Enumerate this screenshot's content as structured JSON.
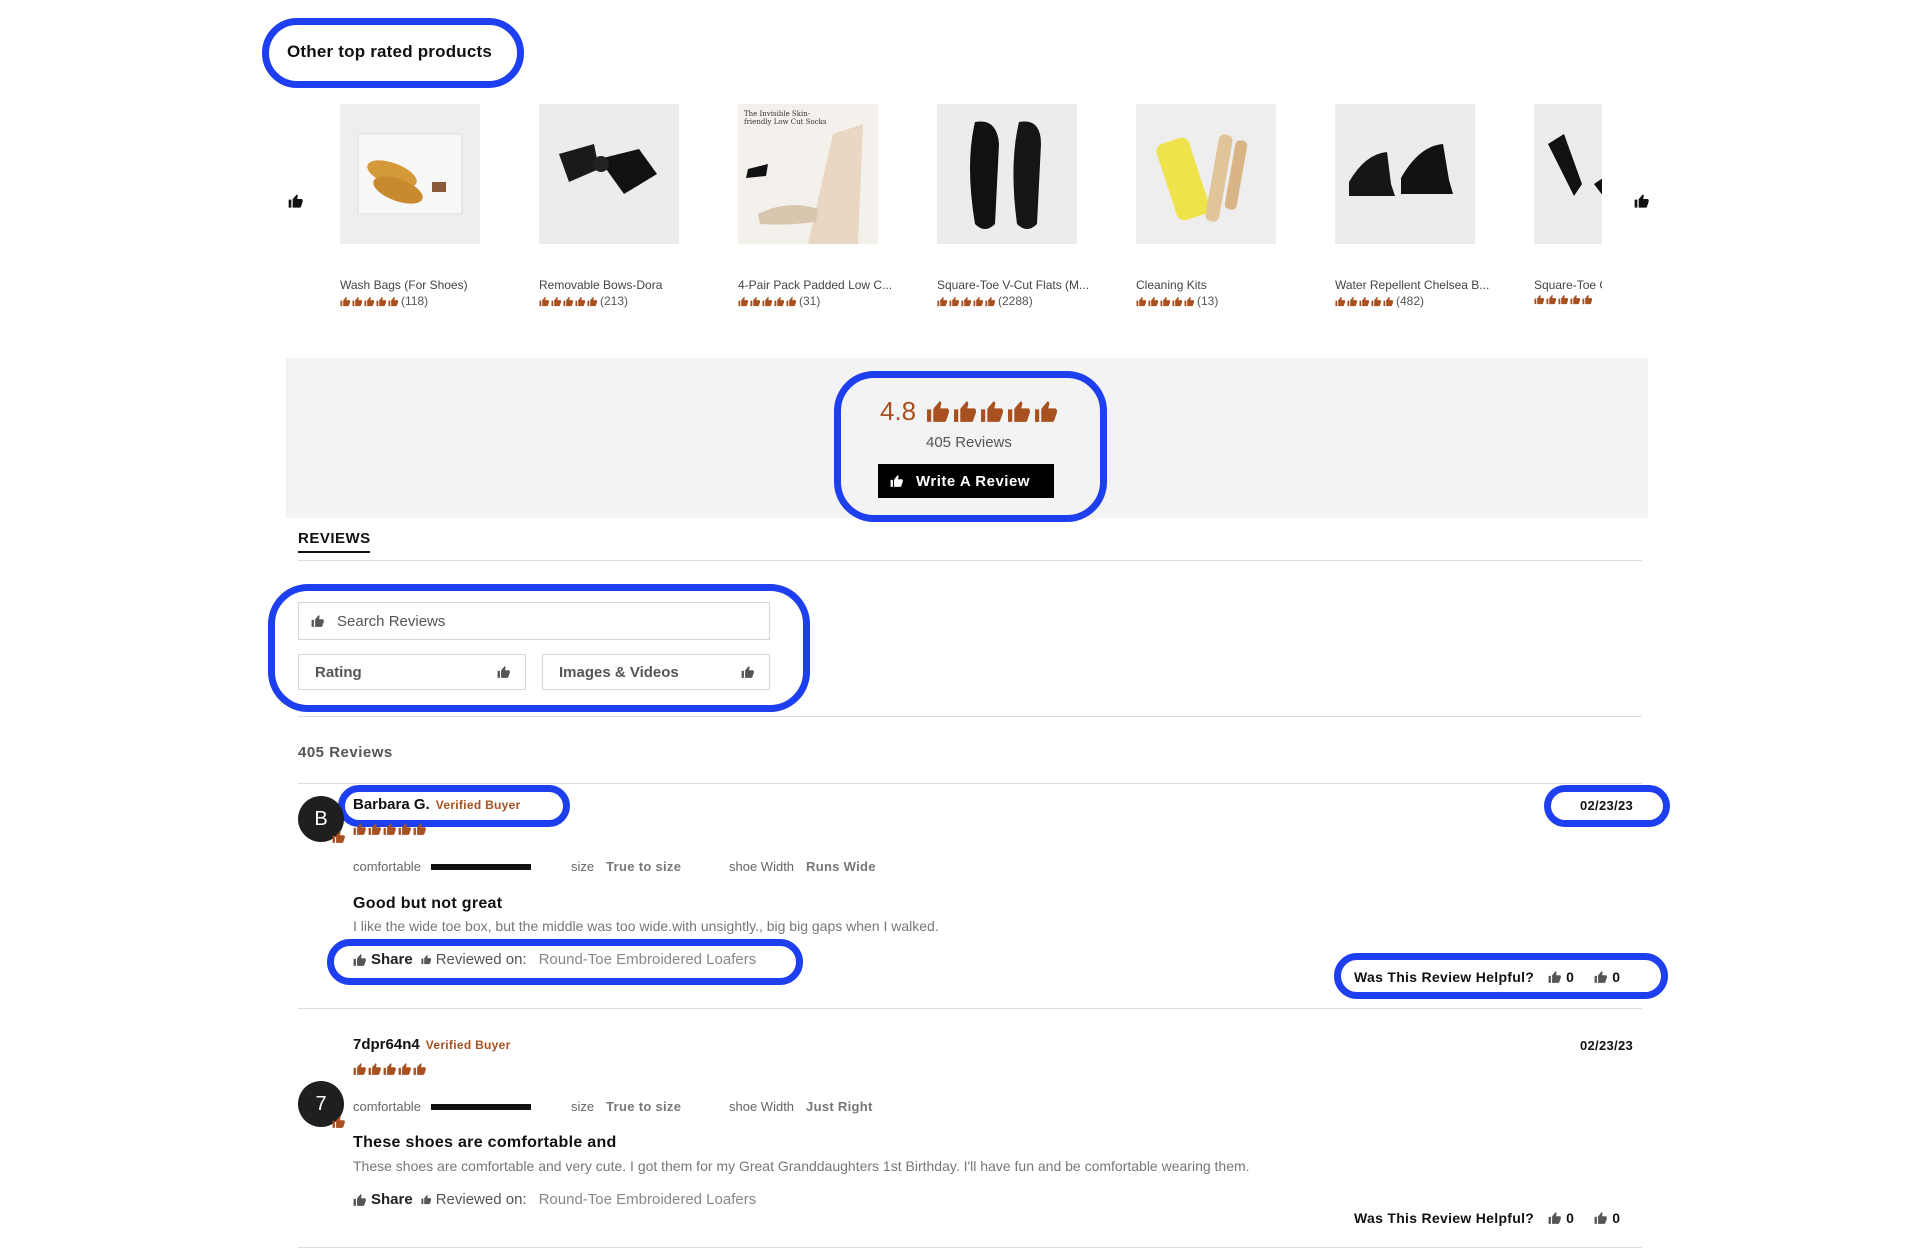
{
  "top_rated": {
    "title": "Other top rated products",
    "products": [
      {
        "name": "Wash Bags (For Shoes)",
        "count": "(118)"
      },
      {
        "name": "Removable Bows-Dora",
        "count": "(213)"
      },
      {
        "name": "4-Pair Pack Padded Low C...",
        "count": "(31)",
        "image_caption": "The Invisible Skin-friendly Low Cut Socks"
      },
      {
        "name": "Square-Toe V-Cut Flats (M...",
        "count": "(2288)"
      },
      {
        "name": "Cleaning Kits",
        "count": "(13)"
      },
      {
        "name": "Water Repellent Chelsea B...",
        "count": "(482)"
      },
      {
        "name": "Square-Toe C",
        "count": ""
      }
    ]
  },
  "summary": {
    "score": "4.8",
    "reviews_label": "405 Reviews",
    "write_button": "Write A Review"
  },
  "tabs": {
    "reviews": "REVIEWS"
  },
  "filters": {
    "search_placeholder": "Search Reviews",
    "rating": "Rating",
    "media": "Images & Videos"
  },
  "list": {
    "count_label": "405 Reviews"
  },
  "reviews": [
    {
      "initial": "B",
      "name": "Barbara G.",
      "verified": "Verified Buyer",
      "date": "02/23/23",
      "comfortable_label": "comfortable",
      "size_label": "size",
      "size_value": "True to size",
      "width_label": "shoe Width",
      "width_value": "Runs Wide",
      "title": "Good but not great",
      "body": "I like the wide toe box, but the middle was too wide.with unsightly., big big gaps when I walked.",
      "share": "Share",
      "reviewed_on": "Reviewed on:",
      "product": "Round-Toe Embroidered Loafers",
      "helpful_label": "Was This Review Helpful?",
      "up": "0",
      "down": "0"
    },
    {
      "initial": "7",
      "name": "7dpr64n4",
      "verified": "Verified Buyer",
      "date": "02/23/23",
      "comfortable_label": "comfortable",
      "size_label": "size",
      "size_value": "True to size",
      "width_label": "shoe Width",
      "width_value": "Just Right",
      "title": "These shoes are comfortable and",
      "body": "These shoes are comfortable and very cute. I got them for my Great Granddaughters 1st Birthday. I'll have fun and be comfortable wearing them.",
      "share": "Share",
      "reviewed_on": "Reviewed on:",
      "product": "Round-Toe Embroidered Loafers",
      "helpful_label": "Was This Review Helpful?",
      "up": "0",
      "down": "0"
    }
  ],
  "colors": {
    "accent": "#a8501f",
    "highlight": "#1e3ff0"
  }
}
